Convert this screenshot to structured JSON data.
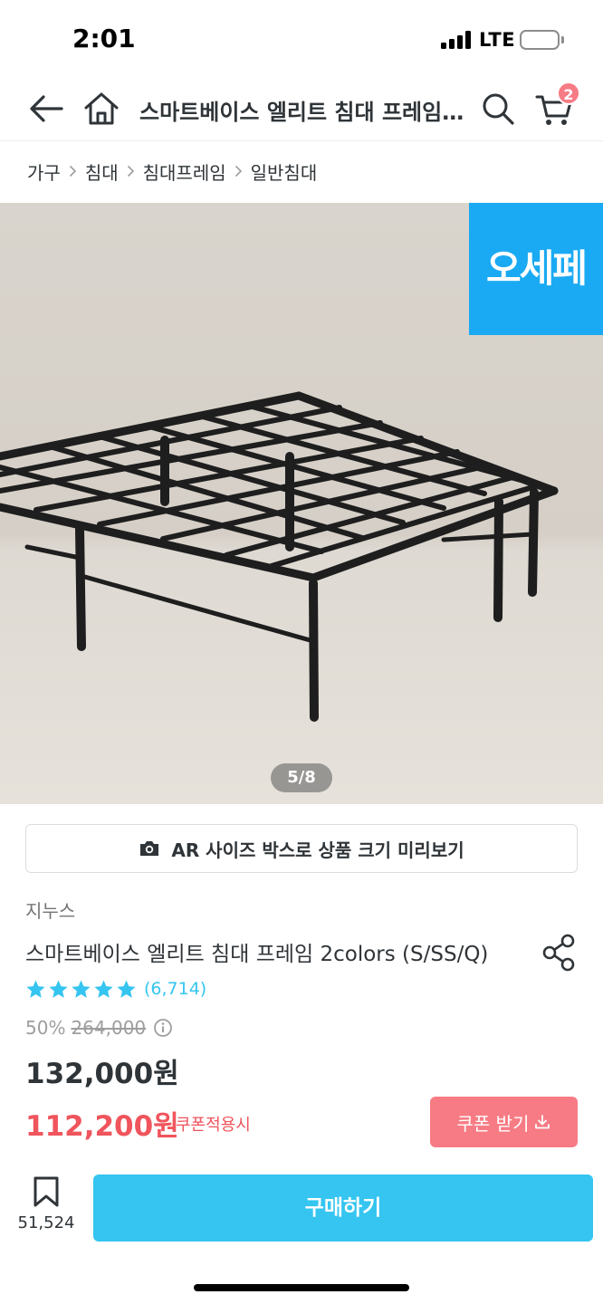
{
  "status_bar": {
    "time": "2:01",
    "network": "LTE"
  },
  "header": {
    "title": "스마트베이스 엘리트 침대 프레임 2colors (S/SS/Q)",
    "cart_count": "2"
  },
  "breadcrumb": [
    "가구",
    "침대",
    "침대프레임",
    "일반침대"
  ],
  "gallery": {
    "brand_badge": "오세페",
    "page_indicator": "5/8"
  },
  "ar_button": {
    "label": "AR 사이즈 박스로 상품 크기 미리보기"
  },
  "product": {
    "brand": "지누스",
    "name": "스마트베이스 엘리트 침대 프레임 2colors (S/SS/Q)",
    "review_count": "(6,714)",
    "discount_rate": "50%",
    "original_price": "264,000",
    "sale_price": "132,000원",
    "coupon_price": "112,200원",
    "coupon_note": "쿠폰적용시",
    "coupon_button": "쿠폰 받기"
  },
  "bottom_bar": {
    "bookmark_count": "51,524",
    "buy_label": "구매하기"
  },
  "colors": {
    "accent": "#35c5f0",
    "coupon": "#f77b84",
    "badge": "#1aaaf3",
    "price_red": "#f0545c"
  }
}
